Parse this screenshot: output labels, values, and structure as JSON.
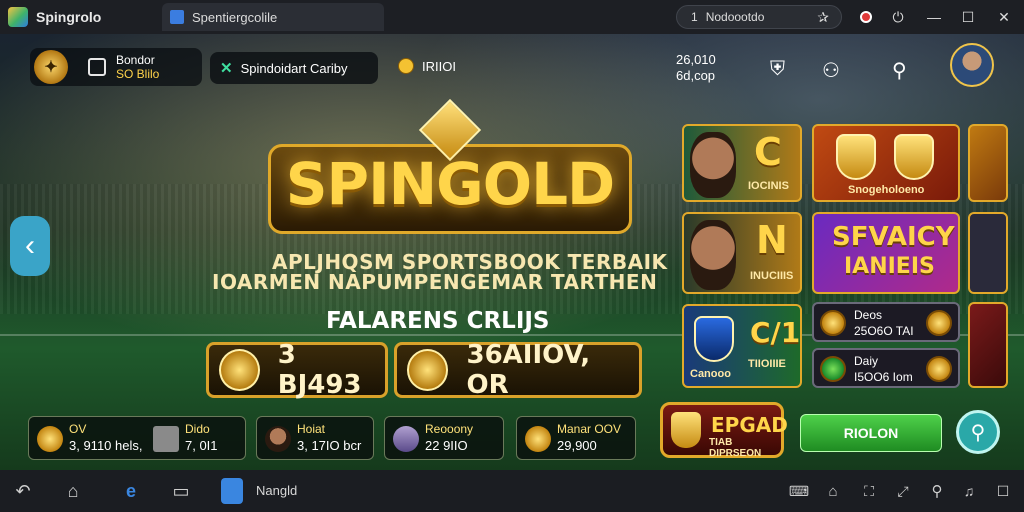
{
  "window": {
    "app_name": "Spingrolo",
    "tab_title": "Spentiergcolile",
    "address": "Nodoootdo",
    "address_prefix": "1"
  },
  "hud": {
    "player_line1": "Bondor",
    "player_line2": "SO Blilo",
    "chip_label": "Spindoidart Cariby",
    "coin_value": "IRIIOI",
    "top_right_line1": "26,010",
    "top_right_line2": "6d,cop"
  },
  "hero": {
    "logo": "SPINGOLD",
    "headline1": "APLJHQSM SPORTSBOOK TERBAIK",
    "headline2": "IOARMEN NAPUMPENGEMAR TARTHEN",
    "subline": "FALARENS CRLIJS",
    "plaque1_value": "3 BJ493",
    "plaque2_value": "36AIIOV, OR"
  },
  "tiles": [
    {
      "big": "C",
      "label": "IOCINIS"
    },
    {
      "big": "",
      "label": "Snogeholoeno"
    },
    {
      "big": "N",
      "label": "INUCIIIS"
    },
    {
      "big": "SFVAICY",
      "big2": "IANIEIS",
      "label": ""
    },
    {
      "big": "C/1",
      "label": "TIIOIIIE",
      "sub": "Canooo"
    },
    {
      "label": "Deos",
      "value": "25O6O TAI"
    },
    {
      "label": "Daiy",
      "value": "I5OO6 Iom"
    }
  ],
  "cards": [
    {
      "l1": "OV",
      "l2": "3, 9110 hels,"
    },
    {
      "l1": "Dido",
      "l2": "7, 0I1"
    },
    {
      "l1": "Hoiat",
      "l2": "3, 17IO bcr"
    },
    {
      "l1": "Reooony",
      "l2": "22 9IIO"
    },
    {
      "l1": "Manar OOV",
      "l2": "29,900"
    }
  ],
  "buttons": {
    "epgad_big": "EPGAD",
    "epgad_small": "TIAB DIPRSEON",
    "green": "RIOLON"
  },
  "taskbar": {
    "label": "Nangld"
  }
}
